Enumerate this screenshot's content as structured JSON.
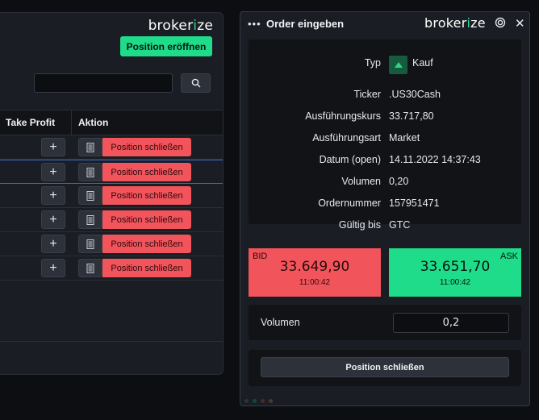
{
  "brand": {
    "name_pre": "broker",
    "name_hl": "i",
    "name_post": "ze"
  },
  "left_panel": {
    "open_position_label": "Position eröffnen",
    "search": {
      "value": "",
      "placeholder": ""
    },
    "columns": [
      "Take Profit",
      "Aktion"
    ],
    "rows": [
      {
        "add_label": "+",
        "close_label": "Position schließen",
        "selected": false
      },
      {
        "add_label": "+",
        "close_label": "Position schließen",
        "selected": true
      },
      {
        "add_label": "+",
        "close_label": "Position schließen",
        "selected": false
      },
      {
        "add_label": "+",
        "close_label": "Position schließen",
        "selected": false
      },
      {
        "add_label": "+",
        "close_label": "Position schließen",
        "selected": false
      },
      {
        "add_label": "+",
        "close_label": "Position schließen",
        "selected": false
      }
    ]
  },
  "order_panel": {
    "title": "Order eingeben",
    "menu_icon": "more-dots-icon",
    "close_icon": "close-icon",
    "details": {
      "typ_label": "Typ",
      "typ_value": "Kauf",
      "ticker_label": "Ticker",
      "ticker_value": ".US30Cash",
      "kurs_label": "Ausführungskurs",
      "kurs_value": "33.717,80",
      "art_label": "Ausführungsart",
      "art_value": "Market",
      "datum_label": "Datum (open)",
      "datum_value": "14.11.2022 14:37:43",
      "volumen_label": "Volumen",
      "volumen_value": "0,20",
      "ordernr_label": "Ordernummer",
      "ordernr_value": "157951471",
      "gueltig_label": "Gültig bis",
      "gueltig_value": "GTC"
    },
    "bid": {
      "label": "BID",
      "price": "33.649,90",
      "time": "11:00:42"
    },
    "ask": {
      "label": "ASK",
      "price": "33.651,70",
      "time": "11:00:42"
    },
    "volume": {
      "label": "Volumen",
      "value": "0,2"
    },
    "submit_label": "Position schließen"
  },
  "colors": {
    "accent_green": "#1fdc8a",
    "accent_red": "#f2545b",
    "selection_blue": "#3a68c9"
  }
}
